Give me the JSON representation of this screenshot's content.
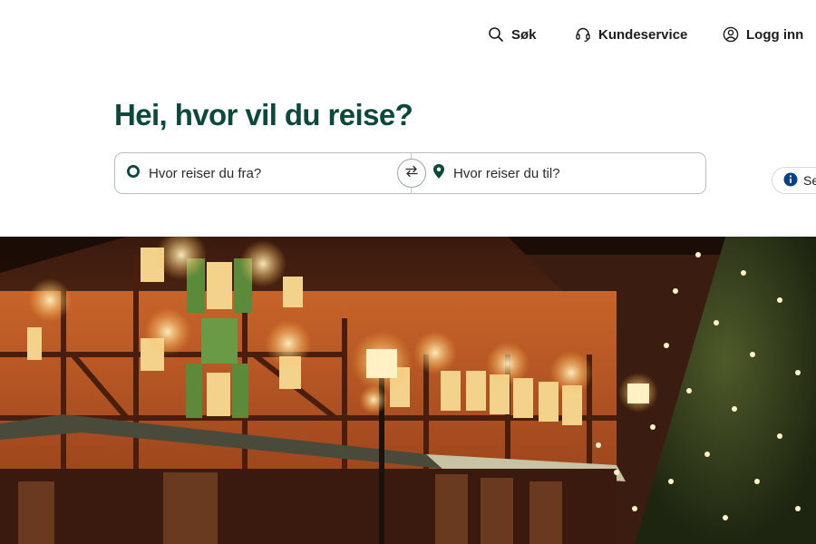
{
  "nav": {
    "search_label": "Søk",
    "customer_service_label": "Kundeservice",
    "login_label": "Logg inn"
  },
  "headline": "Hei, hvor vil du reise?",
  "search": {
    "from_placeholder": "Hvor reiser du fra?",
    "to_placeholder": "Hvor reiser du til?"
  },
  "info_pill": {
    "label": "Se"
  },
  "colors": {
    "brand_green": "#0b4a3a",
    "info_blue": "#0b3f8c"
  },
  "icons": {
    "search": "search-icon",
    "headset": "headset-icon",
    "user": "user-icon",
    "origin": "origin-circle-icon",
    "destination": "location-pin-icon",
    "swap": "swap-arrows-icon",
    "info": "info-icon"
  }
}
